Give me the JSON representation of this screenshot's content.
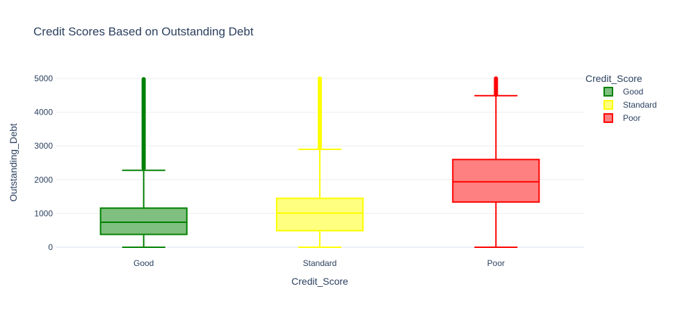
{
  "chart_data": {
    "type": "box",
    "title": "Credit Scores Based on Outstanding Debt",
    "xlabel": "Credit_Score",
    "ylabel": "Outstanding_Debt",
    "ylim": [
      0,
      5000
    ],
    "y_ticks": [
      0,
      1000,
      2000,
      3000,
      4000,
      5000
    ],
    "grid": true,
    "legend": {
      "title": "Credit_Score",
      "placement": "top-right"
    },
    "categories": [
      "Good",
      "Standard",
      "Poor"
    ],
    "series": [
      {
        "name": "Good",
        "color": "#008000",
        "fill": "#7fbf7f",
        "min": 0,
        "q1": 380,
        "median": 740,
        "q3": 1160,
        "upper_fence": 2280,
        "outliers_range": [
          2340,
          5000
        ]
      },
      {
        "name": "Standard",
        "color": "#ffff00",
        "fill": "#ffff80",
        "min": 0,
        "q1": 490,
        "median": 1010,
        "q3": 1450,
        "upper_fence": 2900,
        "outliers_range": [
          2930,
          5000
        ]
      },
      {
        "name": "Poor",
        "color": "#ff0000",
        "fill": "#ff8080",
        "min": 0,
        "q1": 1340,
        "median": 1940,
        "q3": 2600,
        "upper_fence": 4490,
        "outliers_range": [
          4520,
          5000
        ]
      }
    ]
  }
}
